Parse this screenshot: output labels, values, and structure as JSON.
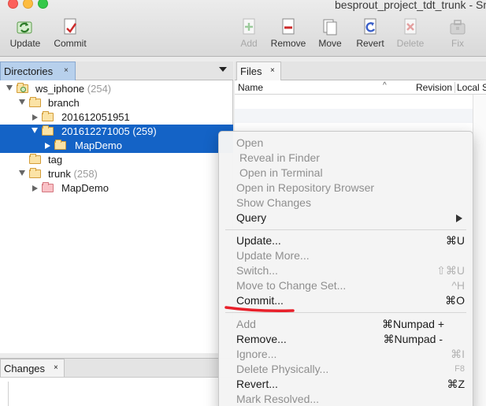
{
  "window": {
    "title": "besprout_project_tdt_trunk - Sm"
  },
  "toolbar": {
    "update": "Update",
    "commit": "Commit",
    "add": "Add",
    "remove": "Remove",
    "move": "Move",
    "revert": "Revert",
    "delete": "Delete",
    "fix": "Fix"
  },
  "directories": {
    "tab_label": "Directories",
    "tab_close": "×",
    "tree": [
      {
        "name": "ws_iphone",
        "count": "(254)"
      },
      {
        "name": "branch",
        "count": ""
      },
      {
        "name": "201612051951",
        "count": ""
      },
      {
        "name": "201612271005 (259)",
        "count": ""
      },
      {
        "name": "MapDemo",
        "count": ""
      },
      {
        "name": "tag",
        "count": ""
      },
      {
        "name": "trunk",
        "count": "(258)"
      },
      {
        "name": "MapDemo",
        "count": ""
      }
    ]
  },
  "changes": {
    "tab_label": "Changes",
    "tab_close": "×"
  },
  "files": {
    "tab_label": "Files",
    "tab_close": "×",
    "columns": {
      "name": "Name",
      "sort": "^",
      "revision": "Revision",
      "local_status": "Local St"
    }
  },
  "context_menu": {
    "items": [
      {
        "label": "Open",
        "shortcut": ""
      },
      {
        "label": "Reveal in Finder",
        "shortcut": ""
      },
      {
        "label": "Open in Terminal",
        "shortcut": ""
      },
      {
        "label": "Open in Repository Browser",
        "shortcut": ""
      },
      {
        "label": "Show Changes",
        "shortcut": ""
      },
      {
        "label": "Query",
        "shortcut": ""
      },
      {
        "label": "Update...",
        "shortcut": "⌘U"
      },
      {
        "label": "Update More...",
        "shortcut": ""
      },
      {
        "label": "Switch...",
        "shortcut": "⇧⌘U"
      },
      {
        "label": "Move to Change Set...",
        "shortcut": "^H"
      },
      {
        "label": "Commit...",
        "shortcut": "⌘O"
      },
      {
        "label": "Add",
        "shortcut": "⌘Numpad +"
      },
      {
        "label": "Remove...",
        "shortcut": "⌘Numpad -"
      },
      {
        "label": "Ignore...",
        "shortcut": "⌘I"
      },
      {
        "label": "Delete Physically...",
        "shortcut": "F8"
      },
      {
        "label": "Revert...",
        "shortcut": "⌘Z"
      },
      {
        "label": "Mark Resolved...",
        "shortcut": ""
      }
    ]
  },
  "colors": {
    "selection": "#1463c6",
    "annotation_underline": "#e8202a"
  }
}
